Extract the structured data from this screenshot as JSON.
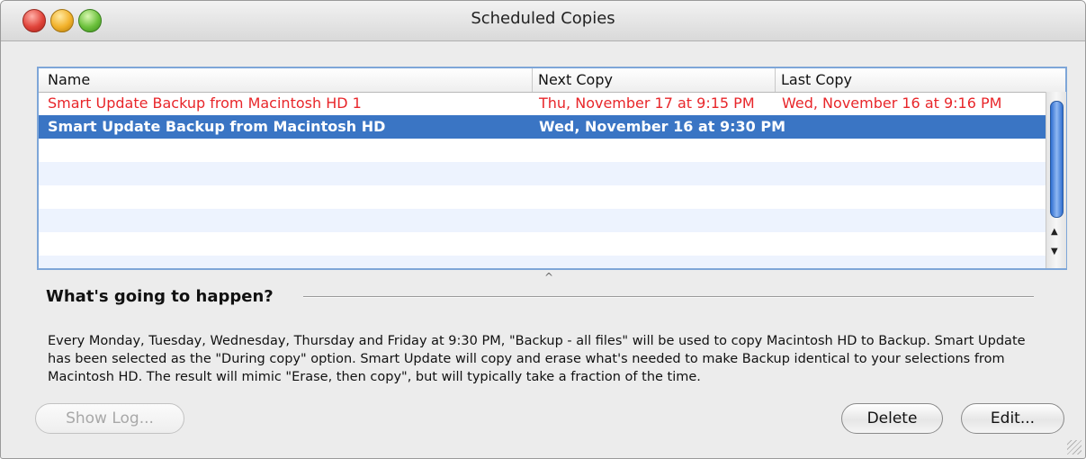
{
  "window": {
    "title": "Scheduled Copies"
  },
  "table": {
    "columns": {
      "name": "Name",
      "next": "Next Copy",
      "last": "Last Copy"
    },
    "rows": [
      {
        "name": "Smart Update Backup from Macintosh HD 1",
        "next": "Thu, November 17 at 9:15 PM",
        "last": "Wed, November 16 at 9:16 PM",
        "state": "error"
      },
      {
        "name": "Smart Update Backup from Macintosh HD",
        "next": "Wed, November 16 at 9:30 PM",
        "last": "",
        "state": "selected"
      }
    ]
  },
  "details": {
    "heading": "What's going to happen?",
    "text": "Every Monday, Tuesday, Wednesday, Thursday and Friday at 9:30 PM, \"Backup - all files\" will be used to copy Macintosh HD to Backup. Smart Update has been selected as the \"During copy\" option. Smart Update will copy and erase what's needed to make Backup identical to your selections from Macintosh HD. The result will mimic \"Erase, then copy\", but will typically take a fraction of the time."
  },
  "buttons": {
    "show_log": "Show Log...",
    "delete": "Delete",
    "edit": "Edit..."
  },
  "colors": {
    "error_text": "#e8262a",
    "selection": "#3a75c4",
    "alt_row": "#edf3fe"
  },
  "icons": {
    "close": "close-button",
    "minimize": "minimize-button",
    "zoom": "zoom-button",
    "scroll_up": "triangle-up",
    "scroll_down": "triangle-down",
    "splitter": "caret-up",
    "resize": "resize-grip"
  }
}
